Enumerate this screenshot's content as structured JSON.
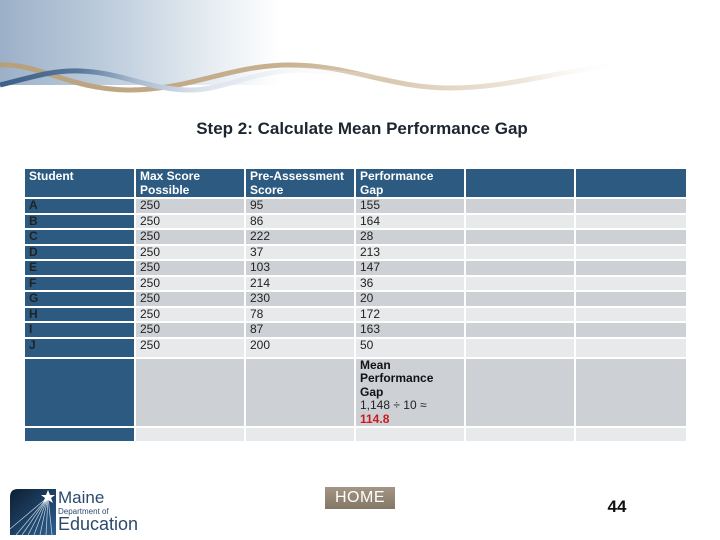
{
  "slide": {
    "title": "Step 2: Calculate Mean Performance Gap",
    "page_number": "44",
    "home_button": "HOME"
  },
  "logo": {
    "line1": "Maine",
    "line2": "Department of",
    "line3": "Education"
  },
  "table": {
    "headers": [
      "Student",
      "Max Score Possible",
      "Pre-Assessment Score",
      "Performance Gap",
      "",
      ""
    ],
    "rows": [
      {
        "student": "A",
        "max": "250",
        "pre": "95",
        "gap": "155"
      },
      {
        "student": "B",
        "max": "250",
        "pre": "86",
        "gap": "164"
      },
      {
        "student": "C",
        "max": "250",
        "pre": "222",
        "gap": "28"
      },
      {
        "student": "D",
        "max": "250",
        "pre": "37",
        "gap": "213"
      },
      {
        "student": "E",
        "max": "250",
        "pre": "103",
        "gap": "147"
      },
      {
        "student": "F",
        "max": "250",
        "pre": "214",
        "gap": "36"
      },
      {
        "student": "G",
        "max": "250",
        "pre": "230",
        "gap": "20"
      },
      {
        "student": "H",
        "max": "250",
        "pre": "78",
        "gap": "172"
      },
      {
        "student": "I",
        "max": "250",
        "pre": "87",
        "gap": "163"
      },
      {
        "student": "J",
        "max": "250",
        "pre": "200",
        "gap": "50"
      }
    ],
    "mean": {
      "label_line1": "Mean",
      "label_line2": "Performance Gap",
      "formula": "1,148 ÷ 10 ≈",
      "value": "114.8"
    }
  },
  "colors": {
    "header_bg": "#2c5a80",
    "row_dark": "#cdd1d6",
    "row_light": "#e8e9eb",
    "mean_value": "#cc1a1a"
  }
}
